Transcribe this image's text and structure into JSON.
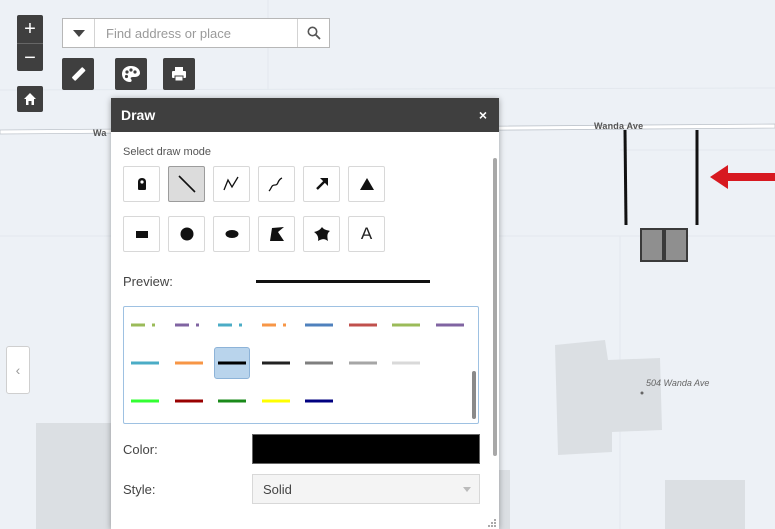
{
  "map": {
    "streets": [
      {
        "name": "Wa"
      },
      {
        "name": "Wanda Ave"
      }
    ],
    "address_label": "504 Wanda Ave",
    "annotation_arrow_color": "#d71920"
  },
  "zoom": {
    "in_label": "+",
    "out_label": "−",
    "in_icon": "plus-icon",
    "out_icon": "minus-icon"
  },
  "home": {
    "icon": "home-icon"
  },
  "search": {
    "value": "",
    "placeholder": "Find address or place",
    "dropdown_icon": "caret-down-icon",
    "icon": "search-icon"
  },
  "toolbar": {
    "items": [
      {
        "name": "measure",
        "icon": "ruler-icon"
      },
      {
        "name": "draw",
        "icon": "paint-palette-icon"
      },
      {
        "name": "print",
        "icon": "printer-icon"
      }
    ]
  },
  "side_panel_toggle": {
    "label": "‹",
    "icon": "chevron-left-icon"
  },
  "draw_panel": {
    "title": "Draw",
    "close_label": "×",
    "mode_label": "Select draw mode",
    "modes": [
      {
        "name": "point",
        "icon": "map-pin-icon"
      },
      {
        "name": "line",
        "icon": "line-icon",
        "active": true
      },
      {
        "name": "polyline",
        "icon": "polyline-icon"
      },
      {
        "name": "freehand-polyline",
        "icon": "freehand-line-icon"
      },
      {
        "name": "arrow",
        "icon": "arrow-icon"
      },
      {
        "name": "triangle",
        "icon": "triangle-icon"
      },
      {
        "name": "rectangle",
        "icon": "rectangle-icon"
      },
      {
        "name": "circle",
        "icon": "circle-icon"
      },
      {
        "name": "ellipse",
        "icon": "ellipse-icon"
      },
      {
        "name": "polygon",
        "icon": "polygon-icon"
      },
      {
        "name": "freehand-polygon",
        "icon": "freehand-polygon-icon"
      },
      {
        "name": "text",
        "label": "A",
        "icon": "text-icon"
      }
    ],
    "preview_label": "Preview:",
    "line_swatches": [
      {
        "color": "#9bbb59",
        "dash": "dashdot"
      },
      {
        "color": "#8064a2",
        "dash": "dashdot"
      },
      {
        "color": "#4bacc6",
        "dash": "dashdot"
      },
      {
        "color": "#f79646",
        "dash": "dashdot"
      },
      {
        "color": "#4f81bd",
        "dash": "solid"
      },
      {
        "color": "#c0504d",
        "dash": "solid"
      },
      {
        "color": "#9bbb59",
        "dash": "solid"
      },
      {
        "color": "#8064a2",
        "dash": "solid"
      },
      {
        "color": "#4bacc6",
        "dash": "solid"
      },
      {
        "color": "#f79646",
        "dash": "solid"
      },
      {
        "color": "#000000",
        "dash": "solid",
        "selected": true
      },
      {
        "color": "#222222",
        "dash": "solid"
      },
      {
        "color": "#7f7f7f",
        "dash": "solid"
      },
      {
        "color": "#a6a6a6",
        "dash": "solid"
      },
      {
        "color": "#d9d9d9",
        "dash": "solid"
      },
      {
        "color": "#33ff33",
        "dash": "solid"
      },
      {
        "color": "#990000",
        "dash": "solid"
      },
      {
        "color": "#1a8a1a",
        "dash": "solid"
      },
      {
        "color": "#ffff00",
        "dash": "solid"
      },
      {
        "color": "#000080",
        "dash": "solid"
      }
    ],
    "color_label": "Color:",
    "color_value": "#000000",
    "style_label": "Style:",
    "style_value": "Solid"
  }
}
